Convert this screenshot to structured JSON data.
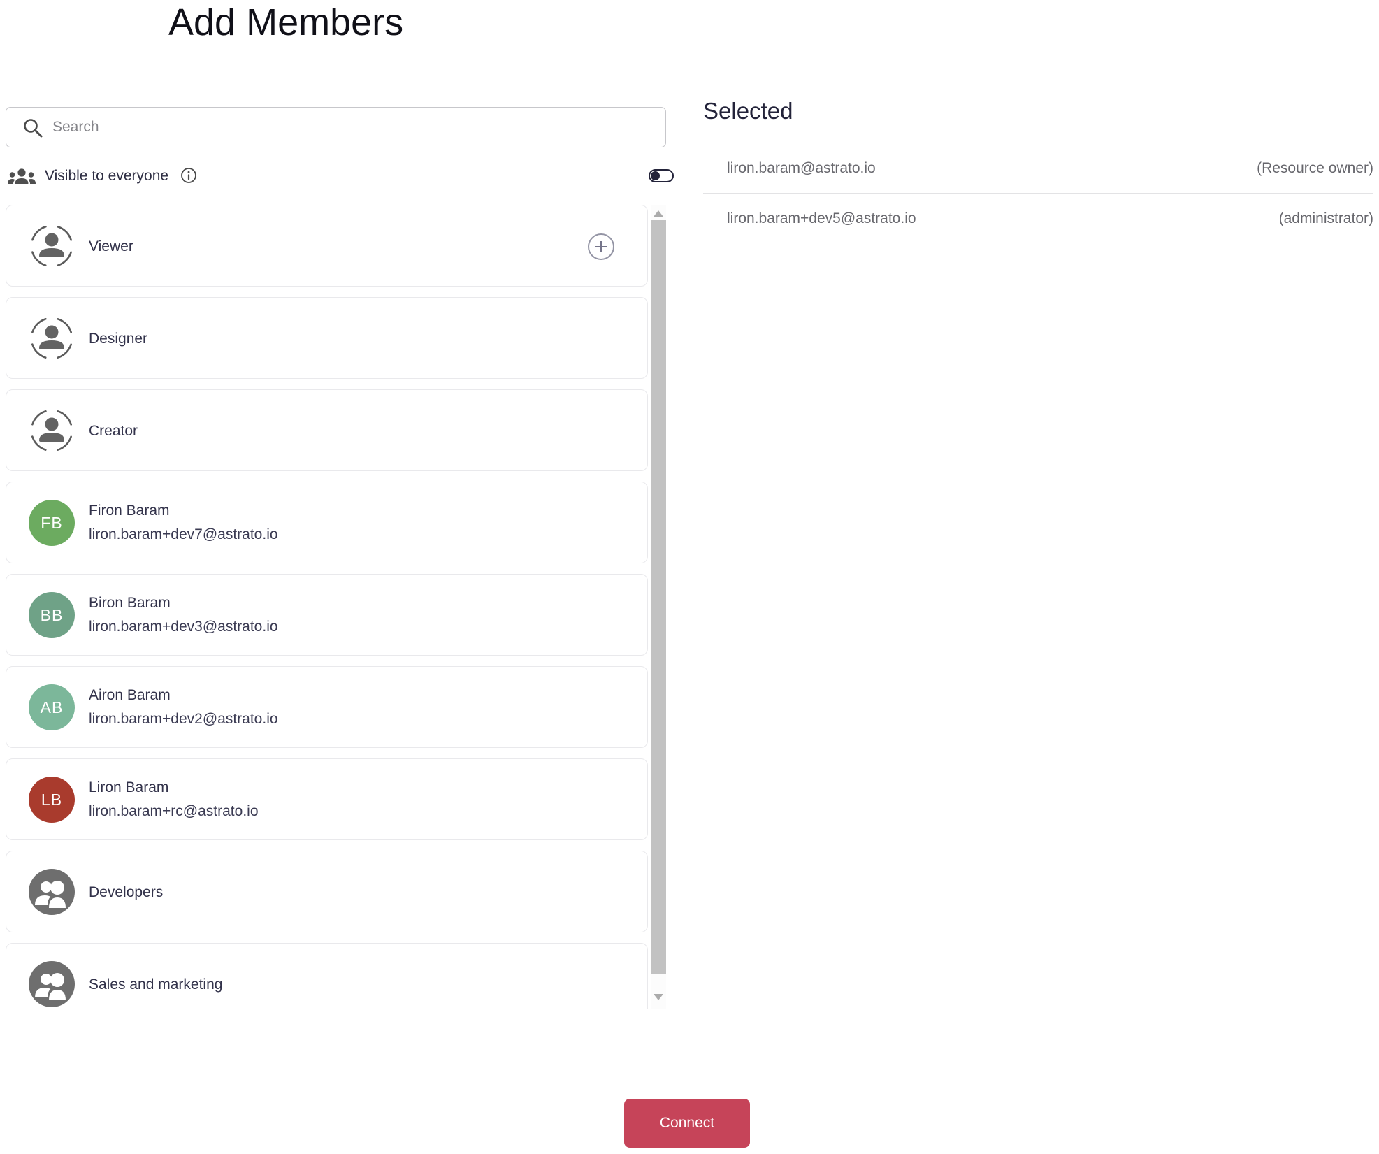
{
  "header": {
    "title": "Add Members"
  },
  "left": {
    "search": {
      "placeholder": "Search",
      "value": ""
    },
    "visibility": {
      "label": "Visible to everyone",
      "state": "off"
    },
    "members": [
      {
        "type": "role",
        "label": "Viewer",
        "show_add_button": true
      },
      {
        "type": "role",
        "label": "Designer",
        "show_add_button": false
      },
      {
        "type": "role",
        "label": "Creator",
        "show_add_button": false
      },
      {
        "type": "user",
        "initials": "FB",
        "name": "Firon Baram",
        "email": "liron.baram+dev7@astrato.io",
        "avatar_color": "#6cab60"
      },
      {
        "type": "user",
        "initials": "BB",
        "name": "Biron Baram",
        "email": "liron.baram+dev3@astrato.io",
        "avatar_color": "#6fa287"
      },
      {
        "type": "user",
        "initials": "AB",
        "name": "Airon Baram",
        "email": "liron.baram+dev2@astrato.io",
        "avatar_color": "#7cb79a"
      },
      {
        "type": "user",
        "initials": "LB",
        "name": "Liron Baram",
        "email": "liron.baram+rc@astrato.io",
        "avatar_color": "#a93b2d"
      },
      {
        "type": "group",
        "label": "Developers"
      },
      {
        "type": "group",
        "label": "Sales and marketing"
      }
    ]
  },
  "right": {
    "heading": "Selected",
    "selected": [
      {
        "email": "liron.baram@astrato.io",
        "role": "(Resource owner)"
      },
      {
        "email": "liron.baram+dev5@astrato.io",
        "role": "(administrator)"
      }
    ]
  },
  "footer": {
    "connect_label": "Connect"
  },
  "colors": {
    "accent_red": "#c64459",
    "icon_gray": "#4f4f4f",
    "toggle_dark": "#23233a",
    "scrollbar_thumb": "#c2c2c2"
  }
}
